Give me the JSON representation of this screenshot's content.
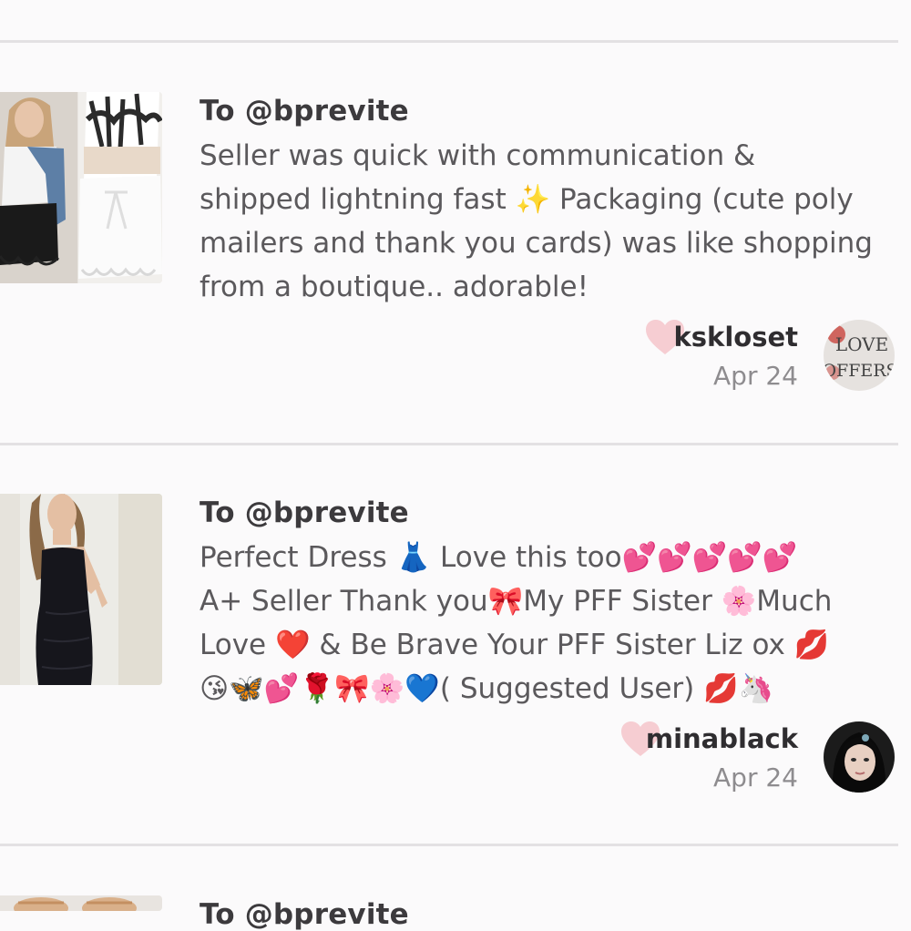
{
  "feed": {
    "reviews": [
      {
        "to_label": "To @bprevite",
        "text_lines": [
          "Seller was quick with communication &",
          "shipped lightning fast ✨ Packaging (cute poly",
          "mailers and thank you cards) was like shopping",
          "from a boutique.. adorable!"
        ],
        "username": "kskloset",
        "date": "Apr 24",
        "avatar_text": [
          "LOVE",
          "OFFERS"
        ],
        "thumbnail": "white-lace-shorts-outfit"
      },
      {
        "to_label": "To @bprevite",
        "text_lines": [
          "Perfect Dress 👗 Love this too💕💕💕💕💕",
          "A+ Seller Thank you🎀My PFF Sister 🌸Much",
          "Love ❤️ & Be Brave Your PFF Sister Liz ox 💋",
          "😘🦋💕🌹🎀🌸💙( Suggested User) 💋🦄"
        ],
        "username": "minablack",
        "date": "Apr 24",
        "thumbnail": "black-bodycon-dress"
      },
      {
        "to_label": "To @bprevite",
        "thumbnail": "sandals"
      }
    ]
  },
  "colors": {
    "background": "#fbfafb",
    "heart": "#f6cdd2",
    "divider": "#e3e1e3",
    "username": "#2f2d30",
    "date": "#8e8c8f"
  },
  "icons": {
    "like": "heart-icon"
  }
}
